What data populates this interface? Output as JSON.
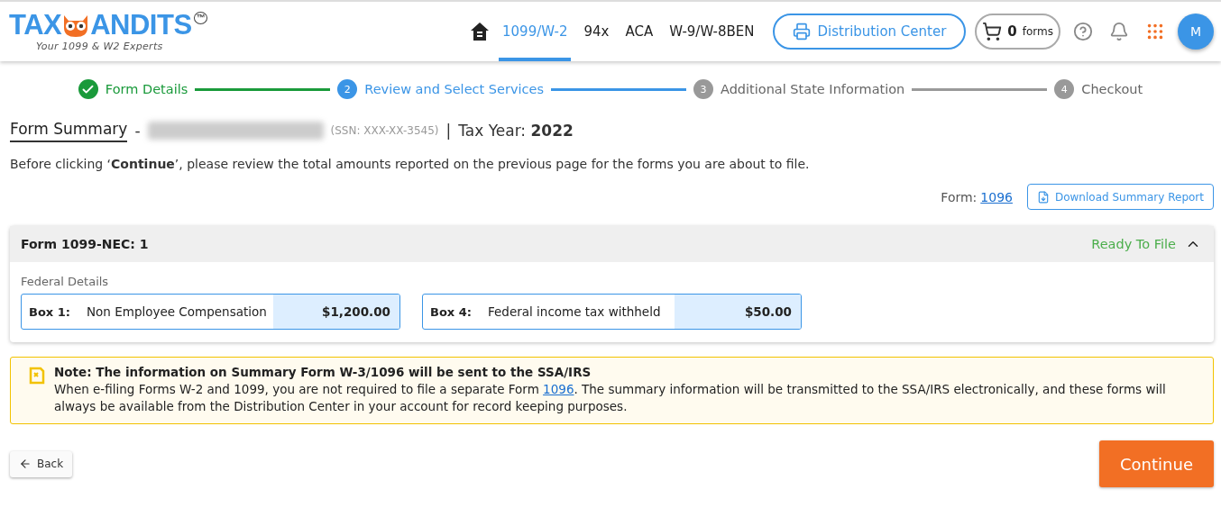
{
  "logo": {
    "brand_left": "TAX",
    "brand_right": "ANDITS",
    "trademark": "™",
    "tagline": "Your 1099 & W2 Experts"
  },
  "nav": {
    "tabs": [
      {
        "label": "1099/W-2",
        "selected": true
      },
      {
        "label": "94x",
        "selected": false
      },
      {
        "label": "ACA",
        "selected": false
      },
      {
        "label": "W-9/W-8BEN",
        "selected": false
      }
    ],
    "distribution_button": "Distribution Center",
    "cart": {
      "count": "0",
      "unit": "forms"
    },
    "avatar": "M"
  },
  "steps": [
    {
      "label": "Form Details",
      "completed": true,
      "selected": false
    },
    {
      "number": "2",
      "label": "Review and Select Services",
      "completed": false,
      "selected": true
    },
    {
      "number": "3",
      "label": "Additional State Information",
      "completed": false,
      "selected": false
    },
    {
      "number": "4",
      "label": "Checkout",
      "completed": false,
      "selected": false
    }
  ],
  "summary": {
    "title": "Form Summary",
    "separator": "-",
    "ssn": "(SSN: XXX-XX-3545)",
    "divider": "|",
    "tax_year_label": "Tax Year:",
    "tax_year": "2022"
  },
  "instruction": "Before clicking ‘**Continue**’, please review the total amounts reported on the previous page for the forms you are about to file.",
  "form_link": {
    "label": "Form:",
    "link": "1096"
  },
  "download_button": "Download Summary Report",
  "form_panel": {
    "title": "Form 1099-NEC: 1",
    "status": "Ready To File",
    "expanded": true,
    "section": "Federal Details",
    "boxes": [
      {
        "box": "Box 1:",
        "label": "Non Employee Compensation",
        "amount": "$1,200.00"
      },
      {
        "box": "Box 4:",
        "label": "Federal income tax withheld",
        "amount": "$50.00"
      }
    ]
  },
  "note": {
    "title": "Note: The information on Summary Form W-3/1096 will be sent to the SSA/IRS",
    "text_before": "When e-filing Forms W-2 and 1099, you are not required to file a separate Form ",
    "link": "1096",
    "text_after": ". The summary information will be transmitted to the SSA/IRS electronically, and these forms will always be available from the Distribution Center in your account for record keeping purposes."
  },
  "back_button": "Back",
  "continue_button": "Continue"
}
